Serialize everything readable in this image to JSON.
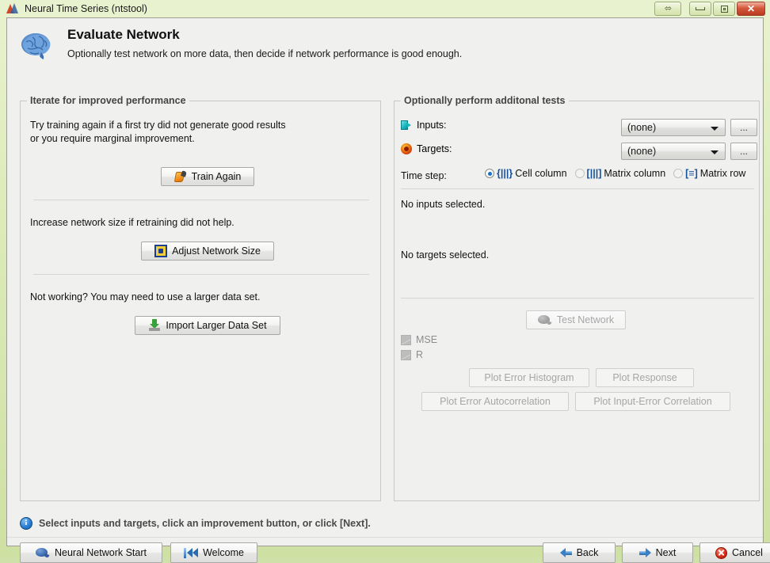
{
  "window": {
    "title": "Neural Time Series (ntstool)",
    "app_icon": "matlab-logo-icon",
    "controls": {
      "resize": "resize-icon",
      "minimize": "minimize-icon",
      "maximize": "maximize-icon",
      "close": "✕"
    }
  },
  "header": {
    "icon": "brain-icon",
    "title": "Evaluate Network",
    "subtitle": "Optionally test network on more data, then decide if network performance is good enough."
  },
  "left_panel": {
    "legend": "Iterate for improved performance",
    "section1": {
      "line1": "Try training again if a first try did not generate good results",
      "line2": "or you require marginal improvement.",
      "button": "Train Again",
      "button_icon": "hand-pointer-icon"
    },
    "section2": {
      "text": "Increase network size if retraining did not help.",
      "button": "Adjust Network Size",
      "button_icon": "network-size-icon"
    },
    "section3": {
      "text": "Not working? You may need to use a larger data set.",
      "button": "Import Larger Data Set",
      "button_icon": "import-icon"
    }
  },
  "right_panel": {
    "legend": "Optionally perform additonal tests",
    "inputs": {
      "icon": "inputs-icon",
      "label": "Inputs:",
      "value": "(none)",
      "browse": "..."
    },
    "targets": {
      "icon": "targets-icon",
      "label": "Targets:",
      "value": "(none)",
      "browse": "..."
    },
    "timestep": {
      "label": "Time step:",
      "options": [
        {
          "label": "Cell column",
          "icon": "cell-column-icon",
          "bracket": "{|||}",
          "selected": true
        },
        {
          "label": "Matrix column",
          "icon": "matrix-column-icon",
          "bracket": "[|||]",
          "selected": false
        },
        {
          "label": "Matrix row",
          "icon": "matrix-row-icon",
          "bracket": "[≡]",
          "selected": false
        }
      ]
    },
    "status": {
      "inputs": "No inputs selected.",
      "targets": "No targets selected."
    },
    "test_button": {
      "label": "Test Network",
      "icon": "brain-icon",
      "disabled": true
    },
    "metrics": [
      {
        "label": "MSE",
        "icon": "plot-icon",
        "disabled": true
      },
      {
        "label": "R",
        "icon": "plot-icon",
        "disabled": true
      }
    ],
    "plot_buttons": [
      {
        "label": "Plot Error Histogram",
        "disabled": true
      },
      {
        "label": "Plot Response",
        "disabled": true
      },
      {
        "label": "Plot Error Autocorrelation",
        "disabled": true
      },
      {
        "label": "Plot Input-Error Correlation",
        "disabled": true
      }
    ]
  },
  "status_bar": {
    "icon": "info-icon",
    "message": "Select inputs and targets, click an improvement button, or click [Next]."
  },
  "footer": {
    "neural_network_start": {
      "label": "Neural Network Start",
      "icon": "brain-icon"
    },
    "welcome": {
      "label": "Welcome",
      "icon": "rewind-icon"
    },
    "back": {
      "label": "Back",
      "icon": "arrow-left-icon"
    },
    "next": {
      "label": "Next",
      "icon": "arrow-right-icon"
    },
    "cancel": {
      "label": "Cancel",
      "icon": "cancel-icon"
    }
  },
  "colors": {
    "frame_green": "#cfe0a3",
    "client_bg": "#f0f0ef",
    "accent_blue": "#2b7fd4",
    "close_red": "#d6593c"
  }
}
